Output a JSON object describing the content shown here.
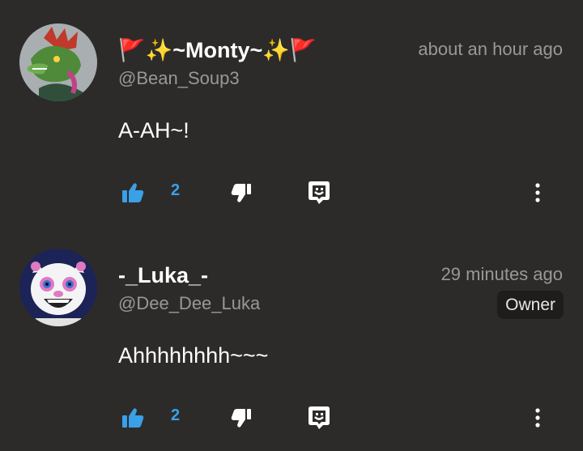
{
  "comments": [
    {
      "display_name": "🚩✨~Monty~✨🚩",
      "handle": "@Bean_Soup3",
      "timestamp": "about an hour ago",
      "badge": "",
      "text": "A-AH~!",
      "likes": "2"
    },
    {
      "display_name": "-_Luka_-",
      "handle": "@Dee_Dee_Luka",
      "timestamp": "29 minutes ago",
      "badge": "Owner",
      "text": "Ahhhhhhhh~~~",
      "likes": "2"
    }
  ],
  "colors": {
    "background": "#2d2b2a",
    "accent_like": "#3aa0e8",
    "muted_text": "#9a9896",
    "primary_text": "#ffffff"
  },
  "icons": {
    "like": "thumbs-up-icon",
    "dislike": "thumbs-down-icon",
    "reply": "speech-bubble-icon",
    "more": "vertical-dots-icon"
  }
}
